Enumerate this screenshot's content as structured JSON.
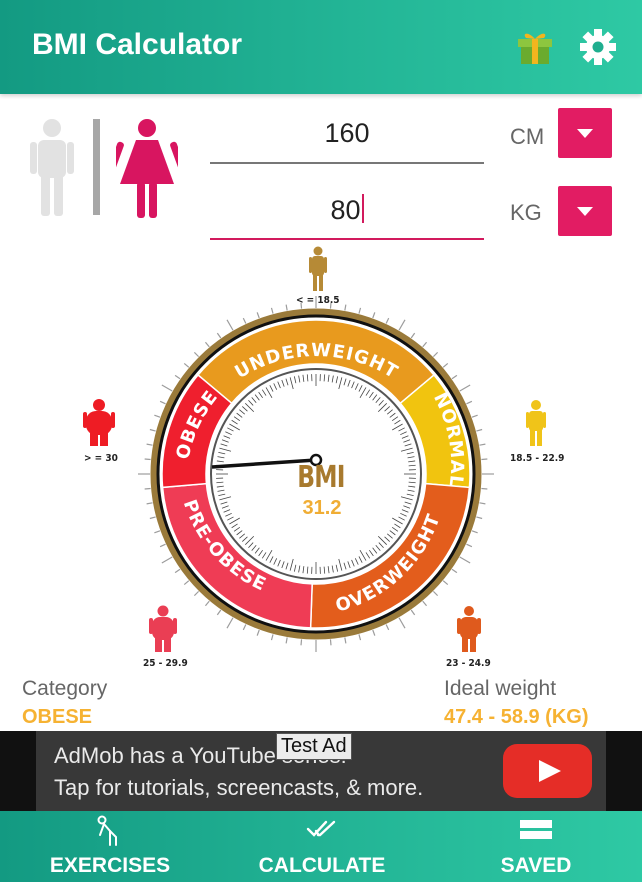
{
  "app": {
    "title": "BMI Calculator"
  },
  "inputs": {
    "height_value": "160",
    "height_unit": "CM",
    "weight_value": "80",
    "weight_unit": "KG"
  },
  "gauge": {
    "segments": [
      "UNDERWEIGHT",
      "NORMAL",
      "OVERWEIGHT",
      "PRE-OBESE",
      "OBESE"
    ],
    "segment_colors": {
      "underweight": "#e89a1e",
      "normal": "#f1c40f",
      "overweight": "#e35d1c",
      "pre_obese": "#ef3c55",
      "obese": "#ef1f2e"
    },
    "ranges": {
      "underweight": "< = 18.5",
      "normal": "18.5 - 22.9",
      "overweight": "23 - 24.9",
      "pre_obese": "25 - 29.9",
      "obese": "> = 30"
    },
    "label": "BMI",
    "value": "31.2"
  },
  "result": {
    "category_label": "Category",
    "category_value": "OBESE",
    "ideal_label": "Ideal weight",
    "ideal_value": "47.4 - 58.9 (KG)"
  },
  "ad": {
    "line1": "AdMob has a YouTube series!",
    "line2": "Tap for tutorials, screencasts, & more.",
    "badge": "Test Ad"
  },
  "nav": {
    "exercises": "EXERCISES",
    "calculate": "CALCULATE",
    "saved": "SAVED"
  },
  "colors": {
    "primary": "#1fae8f",
    "accent": "#e21c63",
    "result": "#f6b232"
  }
}
